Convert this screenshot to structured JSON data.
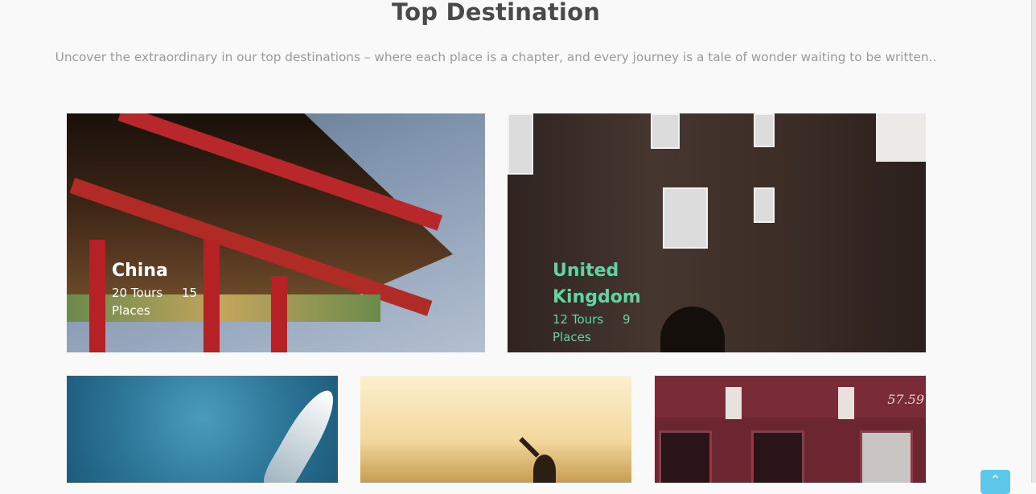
{
  "section": {
    "title": "Top Destination",
    "subtitle": "Uncover the extraordinary in our top destinations – where each place is a chapter, and every journey is a tale of wonder waiting to be written.."
  },
  "destinations": [
    {
      "name": "China",
      "tours": "20 Tours",
      "places_count": "15",
      "places_label": "Places"
    },
    {
      "name": "United Kingdom",
      "tours": "12 Tours",
      "places_count": "9",
      "places_label": "Places"
    }
  ],
  "bottom_cards": {
    "shop_sign_text": "57.59"
  },
  "scroll_top": {
    "icon": "chevron-up-icon",
    "glyph": "⌃"
  },
  "colors": {
    "accent_green": "#5fd6a2",
    "scroll_button": "#5ec8ea",
    "title": "#4a4a4a",
    "subtitle": "#9a9a9a"
  }
}
